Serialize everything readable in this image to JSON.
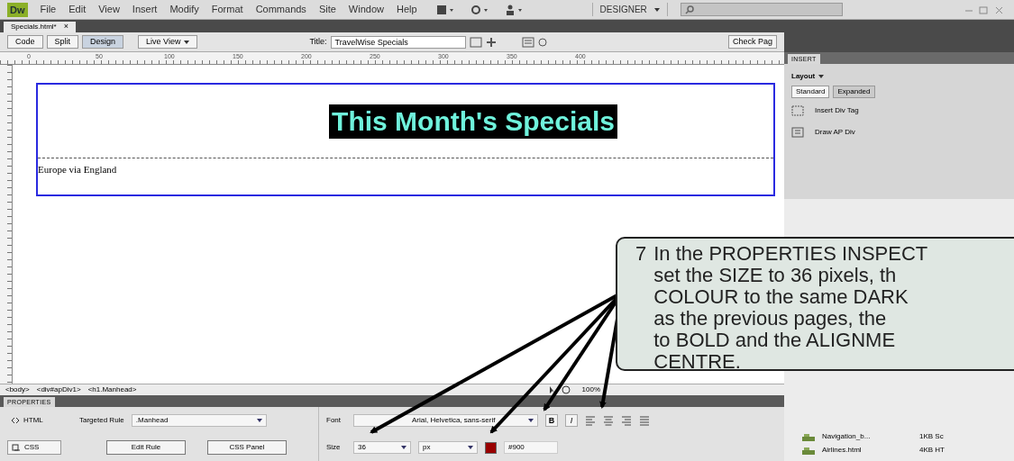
{
  "app": {
    "logo": "Dw",
    "menus": [
      "File",
      "Edit",
      "View",
      "Insert",
      "Modify",
      "Format",
      "Commands",
      "Site",
      "Window",
      "Help"
    ],
    "workspace": "DESIGNER"
  },
  "document_tab": {
    "label": "Specials.html*",
    "close": "×"
  },
  "doc_toolbar": {
    "view_buttons": [
      {
        "label": "Code",
        "selected": false
      },
      {
        "label": "Split",
        "selected": false
      },
      {
        "label": "Design",
        "selected": true
      }
    ],
    "live_view": "Live View",
    "title_label": "Title:",
    "title_value": "TravelWise Specials",
    "check_page": "Check Pag"
  },
  "ruler": [
    "0",
    "50",
    "100",
    "150",
    "200",
    "250",
    "300",
    "350",
    "400"
  ],
  "page": {
    "heading": "This Month's Specials",
    "paragraph": "Europe via England"
  },
  "status_bar": {
    "tags": [
      "<body>",
      "<div#apDiv1>",
      "<h1.Manhead>"
    ],
    "zoom": "100%"
  },
  "properties": {
    "title": "PROPERTIES",
    "modes": [
      {
        "label": "HTML",
        "selected": false
      },
      {
        "label": "CSS",
        "selected": true
      }
    ],
    "targeted_rule_label": "Targeted Rule",
    "targeted_rule": ".Manhead",
    "edit_rule": "Edit Rule",
    "css_panel": "CSS Panel",
    "font_label": "Font",
    "font": "Arial, Helvetica, sans-serif",
    "size_label": "Size",
    "size": "36",
    "unit": "px",
    "color": "#990000",
    "color_text": "#900",
    "format_buttons": [
      {
        "label": "B",
        "kind": "bold"
      },
      {
        "label": "I",
        "kind": "italic"
      }
    ]
  },
  "insert_panel": {
    "tab": "INSERT",
    "category": "Layout",
    "modes": [
      {
        "label": "Standard",
        "selected": true
      },
      {
        "label": "Expanded",
        "selected": false
      }
    ],
    "items": [
      "Insert Div Tag",
      "Draw AP Div"
    ]
  },
  "files": [
    {
      "name": "Navigation_b...",
      "size": "1KB Sc"
    },
    {
      "name": "Airlines.html",
      "size": "4KB HT"
    }
  ],
  "callout": {
    "number": "7",
    "lines": [
      "In the PROPERTIES INSPECT",
      "set the SIZE to 36 pixels, th",
      "COLOUR to the same DARK",
      "as the previous pages, the",
      "to BOLD and the ALIGNME",
      "CENTRE."
    ]
  }
}
